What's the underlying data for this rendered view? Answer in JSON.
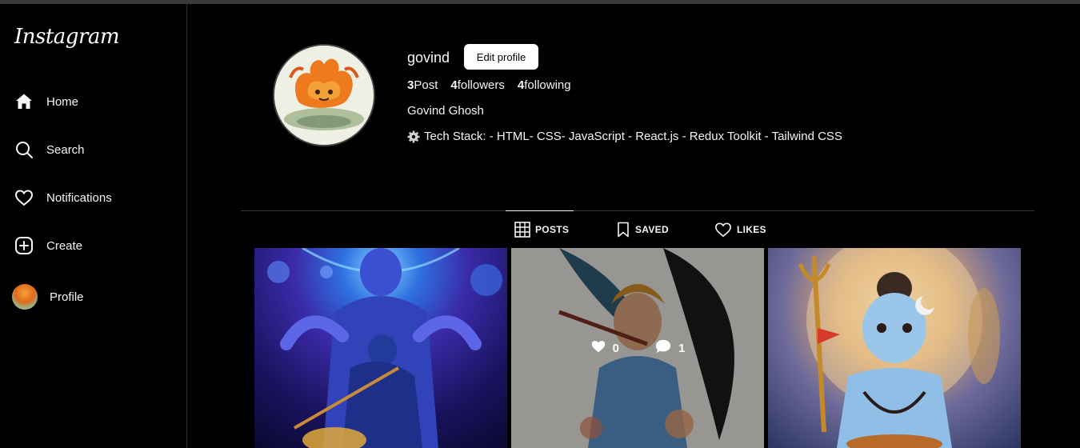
{
  "app": {
    "logo": "Instagram"
  },
  "sidebar": {
    "items": [
      {
        "label": "Home",
        "icon": "home-icon"
      },
      {
        "label": "Search",
        "icon": "search-icon"
      },
      {
        "label": "Notifications",
        "icon": "heart-icon"
      },
      {
        "label": "Create",
        "icon": "plus-square-icon"
      },
      {
        "label": "Profile",
        "icon": "avatar"
      }
    ]
  },
  "profile": {
    "username": "govind",
    "edit_label": "Edit profile",
    "stats": {
      "posts_count": "3",
      "posts_label": "Post",
      "followers_count": "4",
      "followers_label": "followers",
      "following_count": "4",
      "following_label": "following"
    },
    "full_name": "Govind Ghosh",
    "bio": "Tech Stack: - HTML- CSS- JavaScript - React.js - Redux Toolkit - Tailwind CSS"
  },
  "tabs": [
    {
      "label": "POSTS",
      "icon": "grid-icon",
      "active": true
    },
    {
      "label": "SAVED",
      "icon": "bookmark-icon",
      "active": false
    },
    {
      "label": "LIKES",
      "icon": "heart-icon",
      "active": false
    }
  ],
  "posts": [
    {
      "likes": "",
      "comments": ""
    },
    {
      "likes": "0",
      "comments": "1"
    },
    {
      "likes": "",
      "comments": ""
    }
  ],
  "colors": {
    "background": "#000000",
    "text": "#f5f5f5",
    "button": "#ffffff"
  }
}
